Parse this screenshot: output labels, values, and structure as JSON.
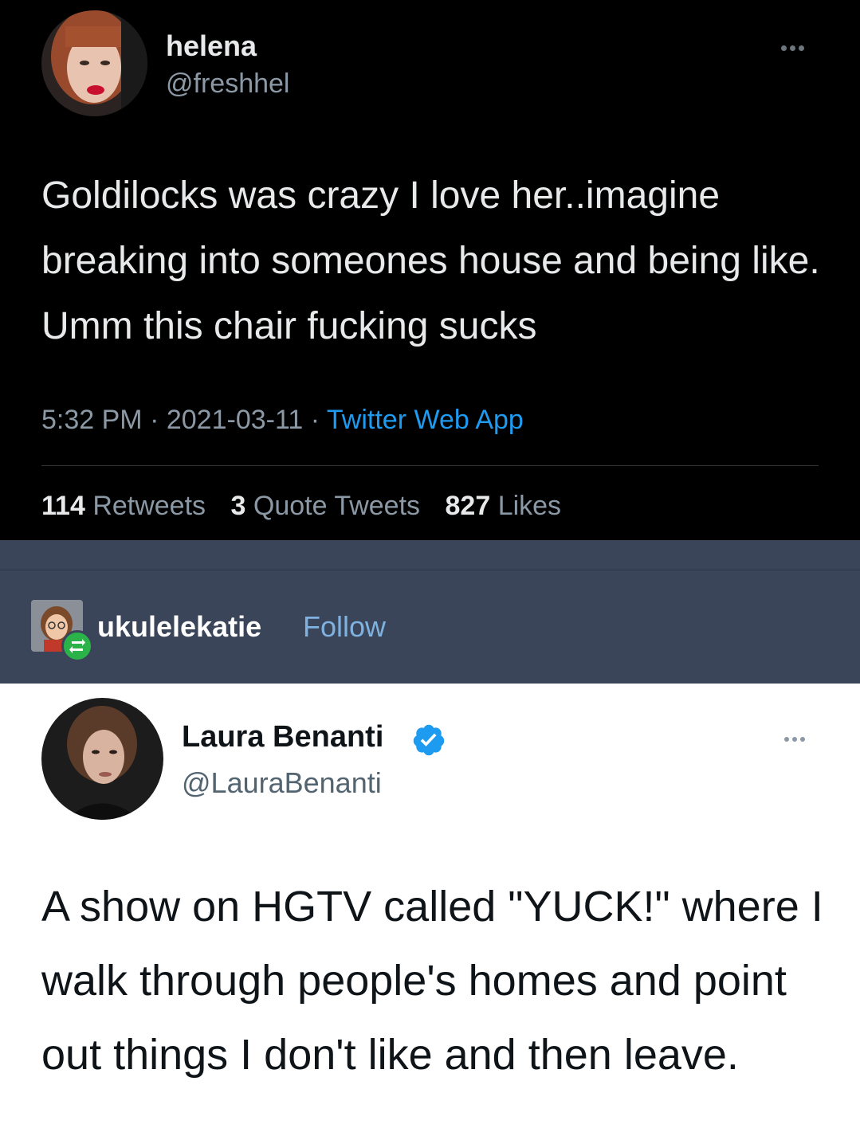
{
  "tweet1": {
    "display_name": "helena",
    "handle": "@freshhel",
    "text": "Goldilocks was crazy I love her..imagine breaking into someones house and being like. Umm this chair fucking sucks",
    "time": "5:32 PM",
    "separator": "·",
    "date": "2021-03-11",
    "source": "Twitter Web App",
    "stats": {
      "retweets_count": "114",
      "retweets_label": "Retweets",
      "quotes_count": "3",
      "quotes_label": "Quote Tweets",
      "likes_count": "827",
      "likes_label": "Likes"
    }
  },
  "reblog": {
    "username": "ukulelekatie",
    "follow_label": "Follow"
  },
  "tweet2": {
    "display_name": "Laura Benanti",
    "handle": "@LauraBenanti",
    "text": "A show on HGTV called \"YUCK!\" where I walk through people's homes and point out things I don't like and then leave."
  },
  "colors": {
    "dark_bg": "#000000",
    "tumblr_bar": "#3a4559",
    "twitter_blue": "#1d9bf0",
    "reblog_green": "#2bb34a",
    "follow_blue": "#7fb2e0"
  },
  "icons": {
    "more": "more-options-icon",
    "verified": "verified-badge-icon",
    "reblog": "reblog-icon"
  }
}
